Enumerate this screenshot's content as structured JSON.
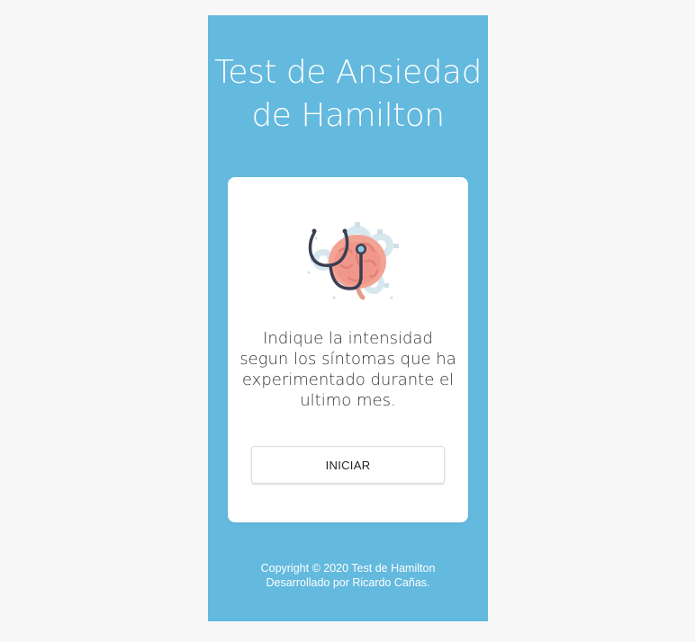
{
  "header": {
    "title_line1": "Test de Ansiedad",
    "title_line2": "de Hamilton"
  },
  "card": {
    "illustration_icon": "stethoscope-brain-icon",
    "instructions": "Indique la intensidad segun los síntomas que ha experimentado durante el ultimo mes.",
    "start_label": "INICIAR"
  },
  "footer": {
    "copyright": "Copyright © 2020 Test de Hamilton",
    "credit": "Desarrollado por Ricardo Cañas."
  },
  "colors": {
    "background": "#f7f7f7",
    "panel": "#63b9de",
    "card": "#ffffff",
    "brain": "#f3a394",
    "stethoscope": "#3b3f52"
  }
}
